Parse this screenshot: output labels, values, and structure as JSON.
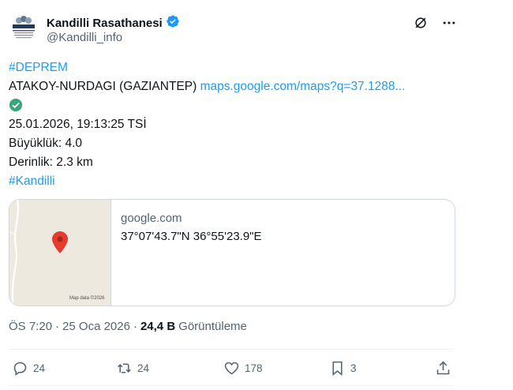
{
  "author": {
    "display_name": "Kandilli Rasathanesi",
    "handle": "@Kandilli_info",
    "avatar_text": "KANDILLI"
  },
  "tweet": {
    "hashtag1": "#DEPREM",
    "location": "ATAKOY-NURDAGI (GAZIANTEP)",
    "link": "maps.google.com/maps?q=37.1288...",
    "datetime": "25.01.2026, 19:13:25 TSİ",
    "magnitude": "Büyüklük: 4.0",
    "depth": "Derinlik: 2.3 km",
    "hashtag2": "#Kandilli"
  },
  "card": {
    "domain": "google.com",
    "coords": "37°07'43.7\"N 36°55'23.9\"E",
    "map_credit": "Map data ©2026"
  },
  "meta": {
    "time": "ÖS 7:20",
    "sep": "·",
    "date": "25 Oca 2026",
    "sep2": "·",
    "views_count": "24,4 B",
    "views_label": "Görüntüleme"
  },
  "actions": {
    "replies": "24",
    "retweets": "24",
    "likes": "178",
    "bookmarks": "3"
  },
  "colors": {
    "accent": "#1d9bf0",
    "verified": "#1d9bf0",
    "check_green": "#00ba7c"
  }
}
